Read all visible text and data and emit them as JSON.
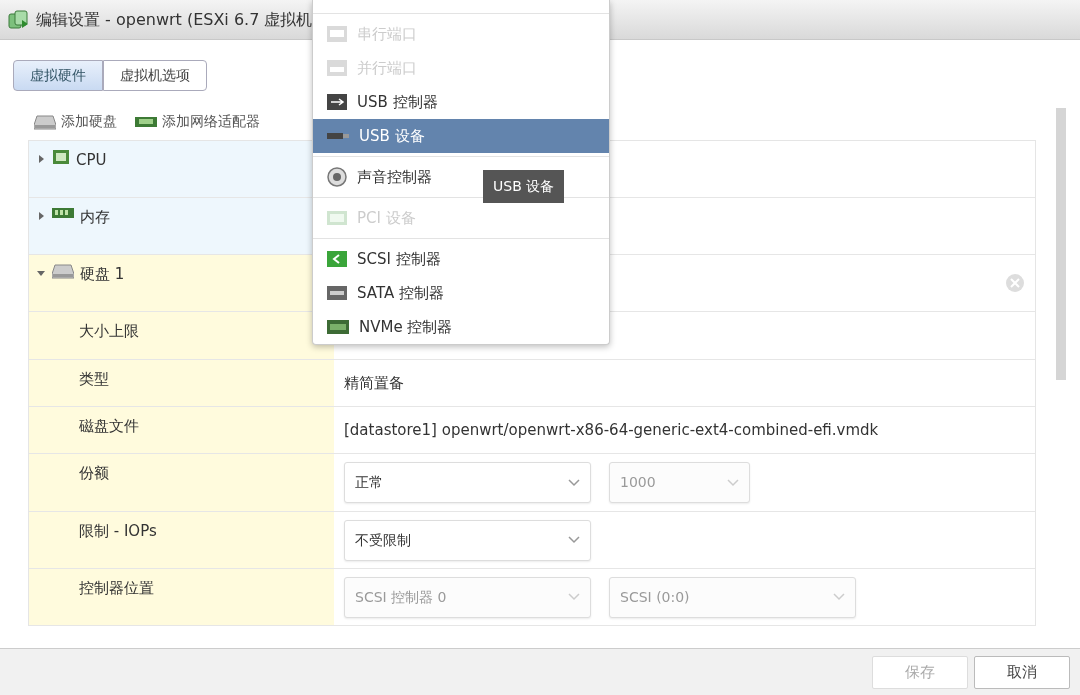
{
  "window": {
    "title": "编辑设置 - openwrt (ESXi 6.7 虚拟机"
  },
  "tabs": [
    {
      "label": "虚拟硬件",
      "selected": true
    },
    {
      "label": "虚拟机选项",
      "selected": false
    }
  ],
  "toolbar": [
    {
      "label": "添加硬盘",
      "kind": "disk"
    },
    {
      "label": "添加网络适配器",
      "kind": "nic"
    }
  ],
  "hardware": [
    {
      "kind": "cpu",
      "label": "CPU",
      "expanded": false
    },
    {
      "kind": "memory",
      "label": "内存",
      "expanded": false
    },
    {
      "kind": "disk",
      "label": "硬盘 1",
      "expanded": true,
      "removable": true
    },
    {
      "kind": "field",
      "label": "大小上限"
    },
    {
      "kind": "field",
      "label": "类型",
      "value": "精简置备"
    },
    {
      "kind": "field",
      "label": "磁盘文件",
      "value": "[datastore1] openwrt/openwrt-x86-64-generic-ext4-combined-efi.vmdk"
    },
    {
      "kind": "field",
      "label": "份额",
      "selects": [
        {
          "value": "正常",
          "disabled": false
        },
        {
          "value": "1000",
          "disabled": true
        }
      ]
    },
    {
      "kind": "field",
      "label": "限制 - IOPs",
      "selects": [
        {
          "value": "不受限制",
          "disabled": false
        }
      ]
    },
    {
      "kind": "field",
      "label": "控制器位置",
      "selects": [
        {
          "value": "SCSI 控制器 0",
          "disabled": true
        },
        {
          "value": "SCSI (0:0)",
          "disabled": true
        }
      ]
    }
  ],
  "menu": {
    "items": [
      {
        "kind": "serial",
        "label": "串行端口",
        "disabled": true,
        "selected": false,
        "divider_before": true
      },
      {
        "kind": "parallel",
        "label": "并行端口",
        "disabled": true,
        "selected": false,
        "divider_before": false
      },
      {
        "kind": "usb",
        "label": "USB 控制器",
        "disabled": false,
        "selected": false,
        "divider_before": false
      },
      {
        "kind": "usbdev",
        "label": "USB 设备",
        "disabled": false,
        "selected": true,
        "divider_before": false
      },
      {
        "kind": "sound",
        "label": "声音控制器",
        "disabled": false,
        "selected": false,
        "divider_before": true
      },
      {
        "kind": "pci",
        "label": "PCI 设备",
        "disabled": true,
        "selected": false,
        "divider_before": true
      },
      {
        "kind": "scsi",
        "label": "SCSI 控制器",
        "disabled": false,
        "selected": false,
        "divider_before": true
      },
      {
        "kind": "sata",
        "label": "SATA 控制器",
        "disabled": false,
        "selected": false,
        "divider_before": false
      },
      {
        "kind": "nvme",
        "label": "NVMe 控制器",
        "disabled": false,
        "selected": false,
        "divider_before": false
      }
    ],
    "tooltip": "USB 设备"
  },
  "footer": {
    "buttons": [
      {
        "label": "保存",
        "disabled": true
      },
      {
        "label": "取消",
        "disabled": false
      }
    ]
  }
}
